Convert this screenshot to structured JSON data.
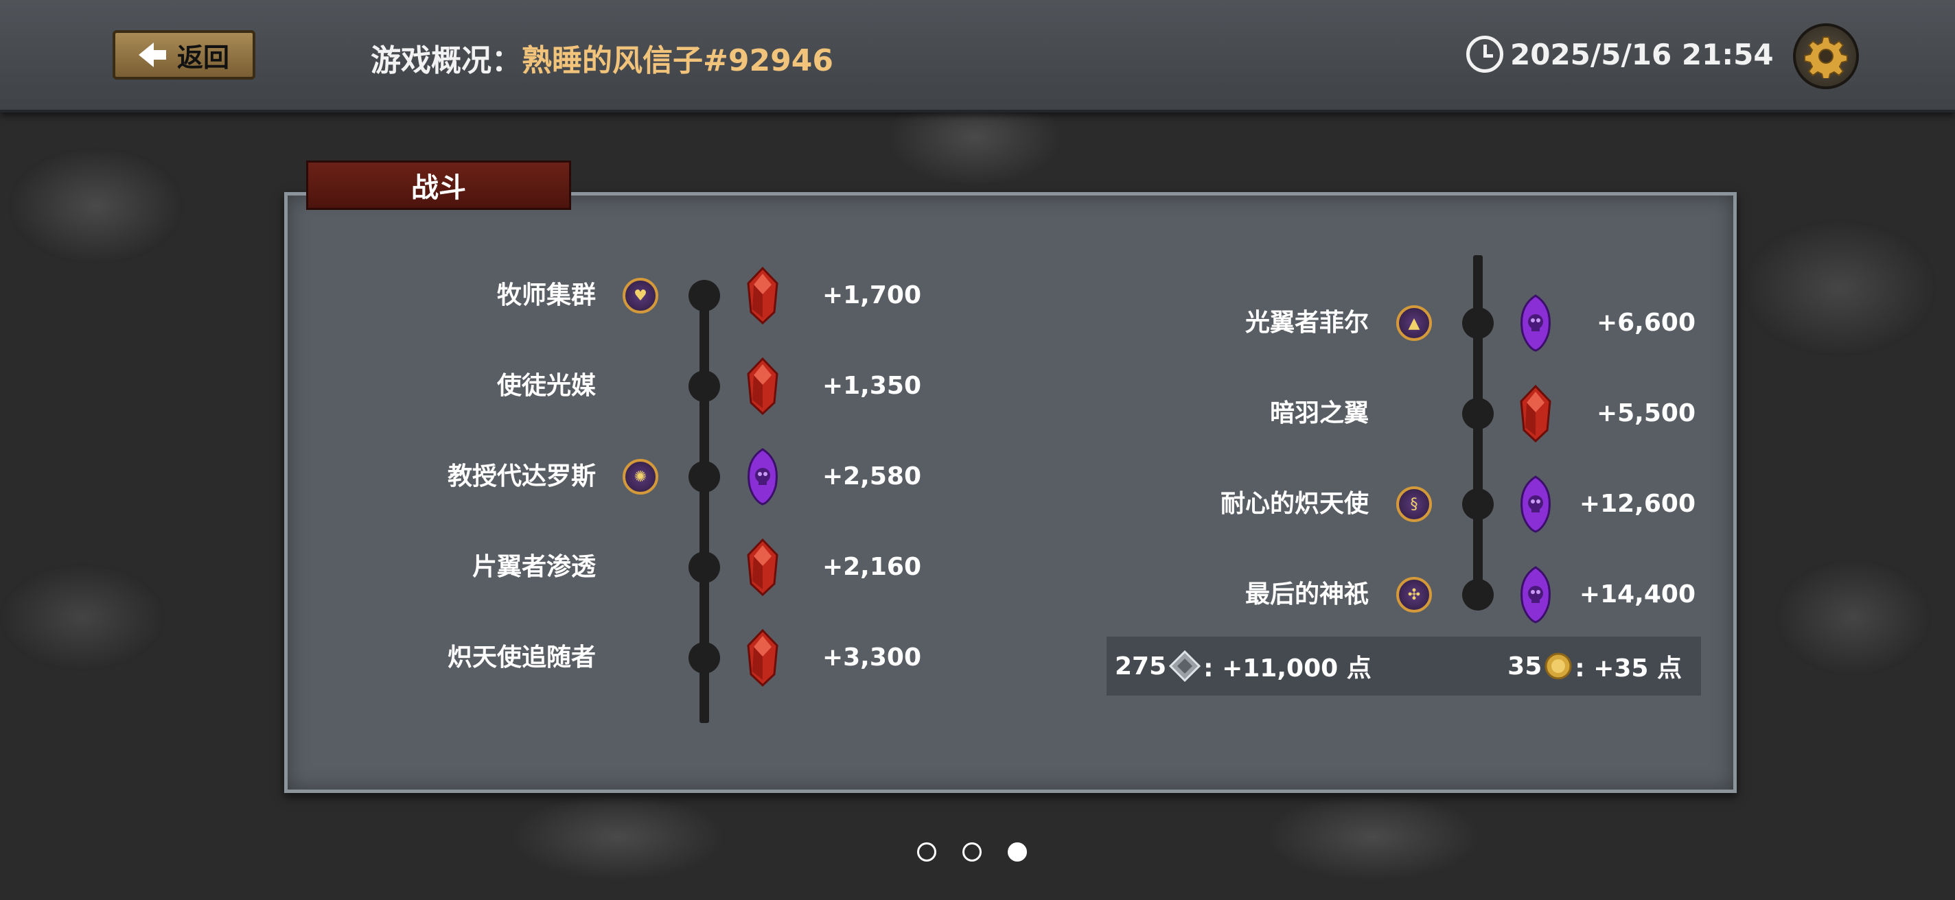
{
  "header": {
    "back_label": "返回",
    "title_label": "游戏概况：",
    "player_name": "熟睡的风信子#92946",
    "datetime": "2025/5/16 21:54"
  },
  "panel": {
    "tab_label": "战斗",
    "left_column": [
      {
        "name": "牧师集群",
        "badge": "heart-badge-icon",
        "gem": "red",
        "value": "+1,700"
      },
      {
        "name": "使徒光媒",
        "badge": null,
        "gem": "red",
        "value": "+1,350"
      },
      {
        "name": "教授代达罗斯",
        "badge": "sun-badge-icon",
        "gem": "purple",
        "value": "+2,580"
      },
      {
        "name": "片翼者渗透",
        "badge": null,
        "gem": "red",
        "value": "+2,160"
      },
      {
        "name": "炽天使追随者",
        "badge": null,
        "gem": "red",
        "value": "+3,300"
      }
    ],
    "right_column": [
      {
        "name": "光翼者菲尔",
        "badge": "triangle-badge-icon",
        "gem": "purple",
        "value": "+6,600"
      },
      {
        "name": "暗羽之翼",
        "badge": null,
        "gem": "red",
        "value": "+5,500"
      },
      {
        "name": "耐心的炽天使",
        "badge": "swirl-badge-icon",
        "gem": "purple",
        "value": "+12,600"
      },
      {
        "name": "最后的神祇",
        "badge": "octopus-badge-icon",
        "gem": "purple",
        "value": "+14,400"
      }
    ],
    "summary": {
      "left_count": "275",
      "left_text": ": +11,000 点",
      "right_count": "35",
      "right_text": ": +35 点"
    }
  },
  "colors": {
    "gem_red": "#c0281c",
    "gem_purple": "#8a2fd6",
    "accent_gold": "#f2c37a",
    "tab_red": "#5a1a12"
  },
  "pagination": {
    "pages": 3,
    "current": 3
  }
}
